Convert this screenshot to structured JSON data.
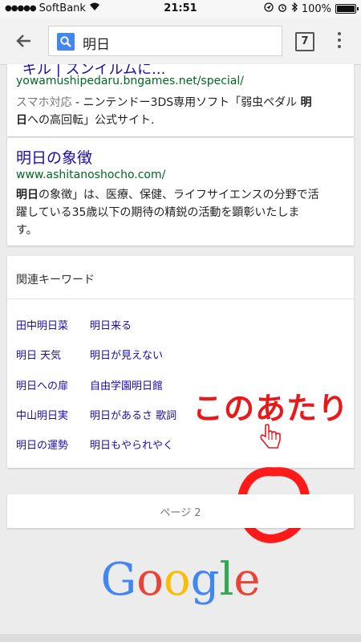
{
  "status_bar": {
    "carrier": "SoftBank",
    "time": "21:51",
    "battery": "100%",
    "battery_level": 1.0
  },
  "toolbar": {
    "query": "明日",
    "tab_count": "7"
  },
  "results": [
    {
      "title_cut": "ギル | スンイルムに...",
      "url": "yowamushipedaru.bngames.net/special/",
      "snippet_prefix": "スマホ対応",
      "snippet_sep": " - ",
      "snippet_main": "ニンテンドー3DS専用ソフト「弱虫ペダル ",
      "snippet_bold1": "明",
      "snippet_bold2": "日",
      "snippet_tail": "への高回転」公式サイト."
    },
    {
      "title": "明日の象徴",
      "url": "www.ashitanoshocho.com/",
      "snippet_bold": "明日",
      "snippet_line1": "の象徴」は、医療、保健、ライフサイエンスの分野で活",
      "snippet_line2": "躍している35歳以下の期待の精鋭の活動を顕彰いたしま",
      "snippet_line3": "す。"
    }
  ],
  "related": {
    "heading": "関連キーワード",
    "items": [
      "田中明日菜",
      "明日来る",
      "明日 天気",
      "明日が見えない",
      "明日への扉",
      "自由学園明日館",
      "中山明日実",
      "明日があるさ 歌詞",
      "明日の運勢",
      "明日もやられやく"
    ]
  },
  "annotation": {
    "text": "このあたり"
  },
  "pagination": {
    "label": "ページ 2"
  },
  "logo": {
    "letters": [
      "G",
      "o",
      "o",
      "g",
      "l",
      "e"
    ],
    "colors": [
      "#4285f4",
      "#ea4335",
      "#fbbc05",
      "#4285f4",
      "#34a853",
      "#ea4335"
    ]
  }
}
